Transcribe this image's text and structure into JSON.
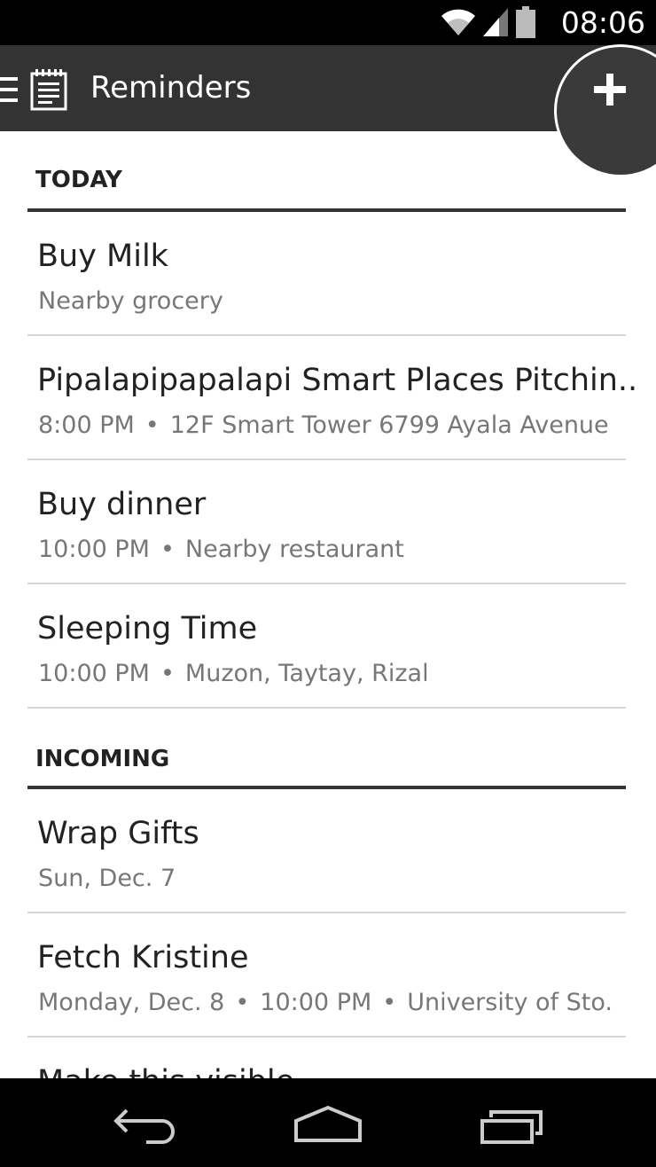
{
  "status_bar": {
    "time": "08:06",
    "icons": [
      "wifi-icon",
      "signal-icon",
      "battery-icon"
    ]
  },
  "action_bar": {
    "title": "Reminders",
    "icons": [
      "menu-icon",
      "notepad-icon",
      "add-icon"
    ]
  },
  "sections": [
    {
      "title": "TODAY",
      "items": [
        {
          "title": "Buy Milk",
          "sub": [
            "Nearby grocery"
          ]
        },
        {
          "title": "Pipalapipapalapi Smart Places Pitchin..",
          "sub": [
            "8:00 PM",
            "12F Smart Tower 6799 Ayala Avenue"
          ]
        },
        {
          "title": "Buy dinner",
          "sub": [
            "10:00 PM",
            "Nearby restaurant"
          ]
        },
        {
          "title": "Sleeping Time",
          "sub": [
            "10:00 PM",
            "Muzon, Taytay, Rizal"
          ]
        }
      ]
    },
    {
      "title": "INCOMING",
      "items": [
        {
          "title": "Wrap Gifts",
          "sub": [
            "Sun, Dec. 7"
          ]
        },
        {
          "title": "Fetch Kristine",
          "sub": [
            "Monday, Dec. 8",
            "10:00 PM",
            "University of Sto."
          ]
        },
        {
          "title": "Make this visible",
          "sub": []
        }
      ]
    }
  ],
  "separator": "•",
  "nav_bar": {
    "icons": [
      "back-icon",
      "home-icon",
      "recent-apps-icon"
    ]
  },
  "colors": {
    "action_bar": "#333333",
    "status_bar": "#000000",
    "divider": "#d6d6d6"
  }
}
